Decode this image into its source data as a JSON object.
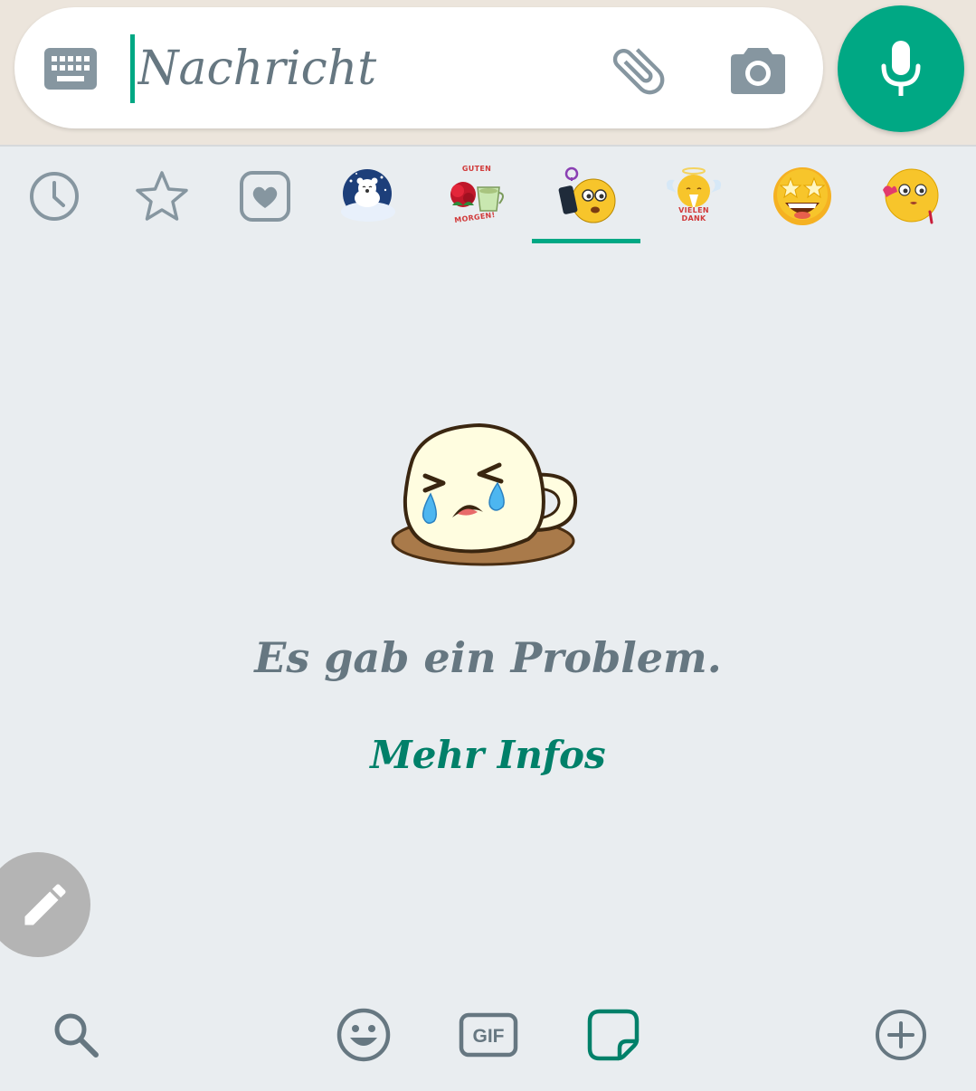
{
  "composer": {
    "placeholder": "Nachricht",
    "icons": [
      "keyboard-icon",
      "paperclip-icon",
      "camera-icon",
      "microphone-icon"
    ]
  },
  "sticker_tabs": {
    "items": [
      {
        "name": "recent",
        "icon": "clock-icon"
      },
      {
        "name": "favorites",
        "icon": "star-icon"
      },
      {
        "name": "heart-pack",
        "icon": "heart-icon"
      },
      {
        "name": "polar-bear-pack",
        "icon": "polar-bear-sticker"
      },
      {
        "name": "guten-morgen-pack",
        "icon": "coffee-roses-sticker",
        "label_top": "GUTEN",
        "label_bottom": "MORGEN!"
      },
      {
        "name": "emoji-phone-pack",
        "icon": "emoji-phone-sticker",
        "selected": true
      },
      {
        "name": "vielen-dank-pack",
        "icon": "angel-emoji-sticker",
        "label_top": "VIELEN",
        "label_bottom": "DANK"
      },
      {
        "name": "star-eyes-pack",
        "icon": "star-eyes-emoji-sticker"
      },
      {
        "name": "kiss-pack",
        "icon": "kissing-emoji-sticker"
      }
    ]
  },
  "error": {
    "message": "Es gab ein Problem.",
    "link_label": "Mehr Infos"
  },
  "colors": {
    "accent": "#00a884",
    "link": "#008069",
    "muted": "#667781",
    "panel_bg": "#e9edf0"
  },
  "bottom_nav": {
    "gif_label": "GIF",
    "icons": [
      "search-icon",
      "emoji-icon",
      "gif-icon",
      "sticker-icon",
      "add-icon"
    ]
  }
}
